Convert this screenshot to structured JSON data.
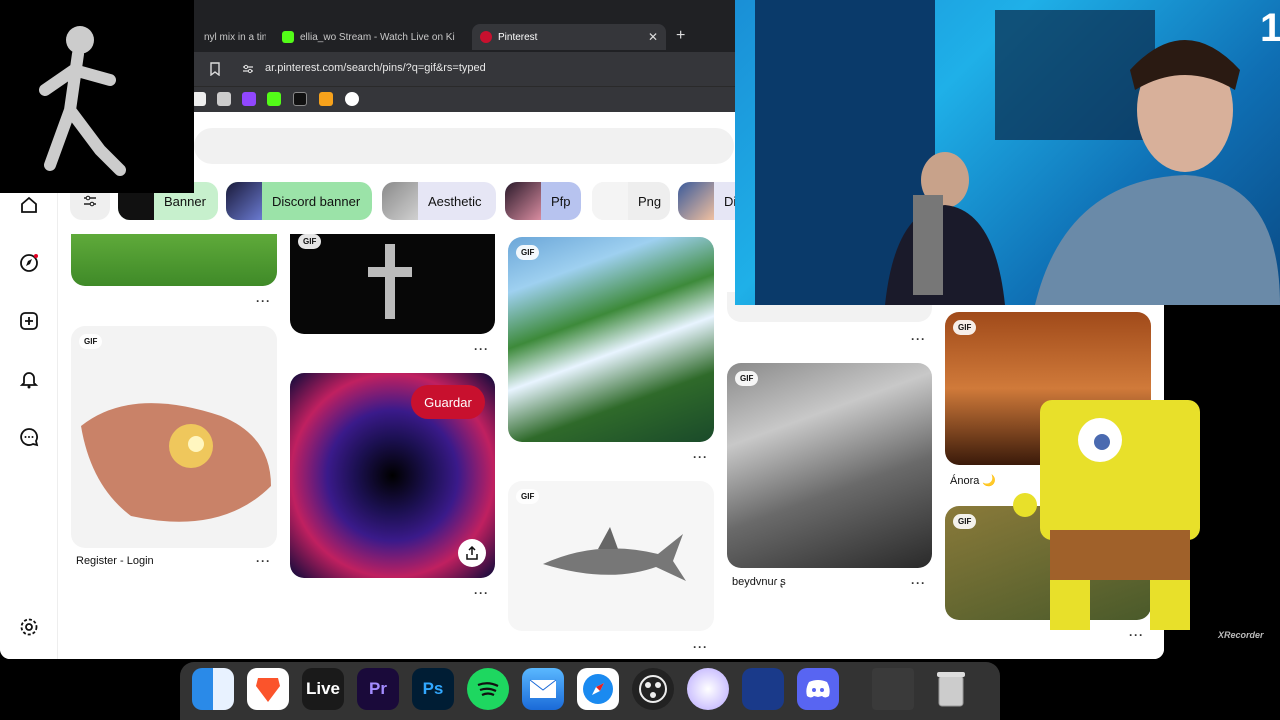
{
  "browser": {
    "tabs": [
      {
        "label": "nyl mix in a tin",
        "favicon": "music-tab-icon"
      },
      {
        "label": "ellia_wo Stream - Watch Live on Ki",
        "favicon": "kick-icon"
      },
      {
        "label": "Pinterest",
        "favicon": "pinterest-icon"
      }
    ],
    "url": "ar.pinterest.com/search/pins/?q=gif&rs=typed"
  },
  "chips": [
    {
      "label": "Banner",
      "color": "#c7f0cd"
    },
    {
      "label": "Discord banner",
      "color": "#9be3a8"
    },
    {
      "label": "Aesthetic",
      "color": "#e6e6f5"
    },
    {
      "label": "Pfp",
      "color": "#b7c3ef"
    },
    {
      "label": "Png",
      "color": "#eeeeee"
    },
    {
      "label": "Di",
      "color": "#e6e6f5"
    }
  ],
  "pins": {
    "gif_badge": "GIF",
    "save_button": "Guardar",
    "titles": {
      "hand": "Register - Login",
      "train": "beydvnuɾ ʂ",
      "couple": "Ánora 🌙"
    },
    "more": "···"
  },
  "overlay": {
    "stream_number": "1",
    "watermark": "XRecorder"
  },
  "dock": {
    "live_label": "Live",
    "pr_label": "Pr",
    "ps_label": "Ps"
  },
  "colors": {
    "pinterest_red": "#c8102e",
    "save_red": "#e60023",
    "webcam_blue": "#1fb0e8"
  }
}
